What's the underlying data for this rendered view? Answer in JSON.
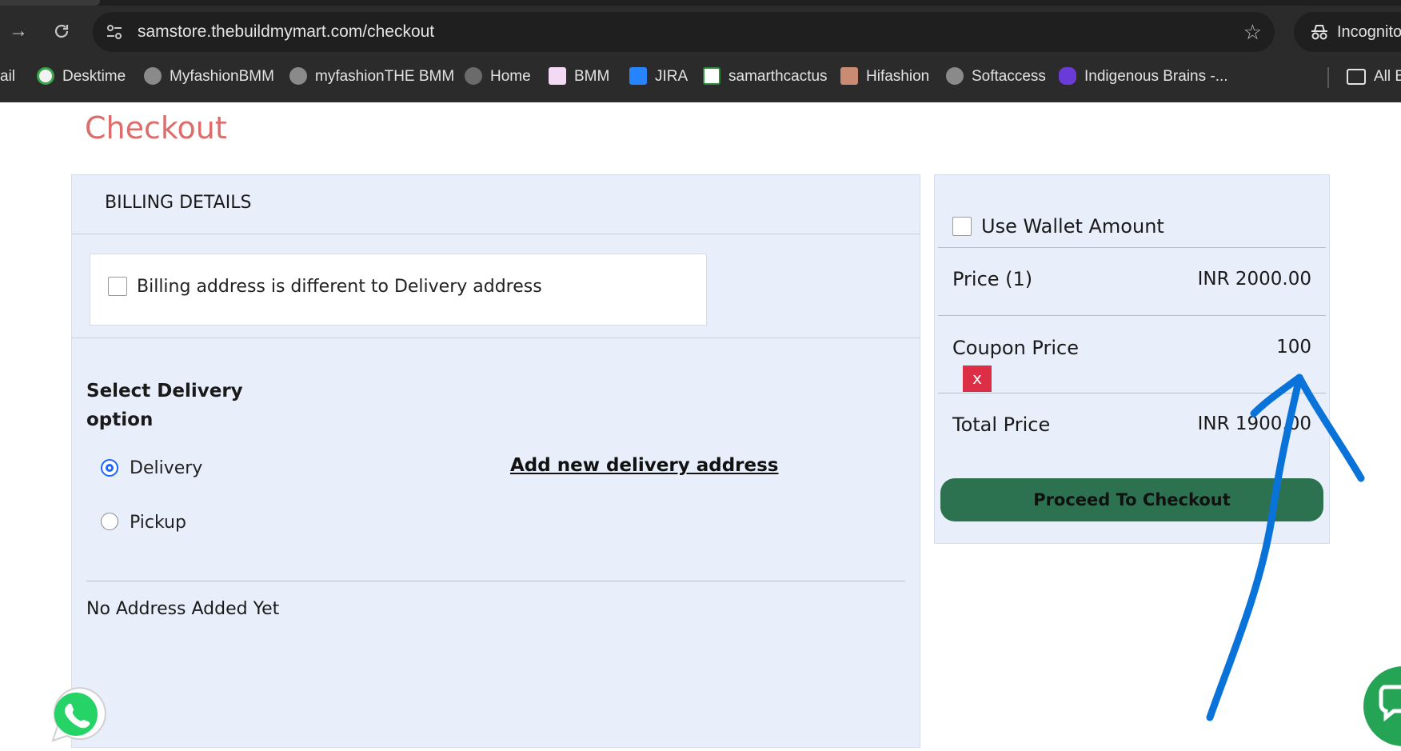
{
  "browser": {
    "url": "samstore.thebuildmymart.com/checkout",
    "incognito_label": "Incognito",
    "bookmarks": [
      {
        "label": "ail",
        "icon": "mail-icon"
      },
      {
        "label": "Desktime",
        "icon": "desktime-icon"
      },
      {
        "label": "MyfashionBMM",
        "icon": "globe-icon"
      },
      {
        "label": "myfashionTHE BMM",
        "icon": "globe-icon"
      },
      {
        "label": "Home",
        "icon": "globe-icon"
      },
      {
        "label": "BMM",
        "icon": "bmm-icon"
      },
      {
        "label": "JIRA",
        "icon": "jira-icon"
      },
      {
        "label": "samarthcactus",
        "icon": "cactus-icon"
      },
      {
        "label": "Hifashion",
        "icon": "hifashion-icon"
      },
      {
        "label": "Softaccess",
        "icon": "globe-icon"
      },
      {
        "label": "Indigenous Brains -...",
        "icon": "indigenous-icon"
      }
    ],
    "all_bookmarks_label": "All B"
  },
  "page": {
    "title": "Checkout"
  },
  "billing": {
    "heading": "BILLING DETAILS",
    "different_address_label": "Billing address is different to Delivery address",
    "select_delivery_label": "Select Delivery option",
    "options": [
      "Delivery",
      "Pickup"
    ],
    "selected_option": "Delivery",
    "add_address_link": "Add new delivery address",
    "no_address_text": "No Address Added Yet"
  },
  "summary": {
    "wallet_label": "Use Wallet Amount",
    "price_label": "Price (1)",
    "price_value": "INR 2000.00",
    "coupon_label": "Coupon Price",
    "coupon_value": "100",
    "remove_coupon_label": "x",
    "total_label": "Total Price",
    "total_value": "INR 1900.00",
    "checkout_button": "Proceed To Checkout"
  },
  "colors": {
    "title": "#dc6d6b",
    "panel_bg": "#e8eefa",
    "checkout_button": "#2d7250",
    "remove_button": "#dc2f45",
    "annotation_stroke": "#0a73d9"
  }
}
